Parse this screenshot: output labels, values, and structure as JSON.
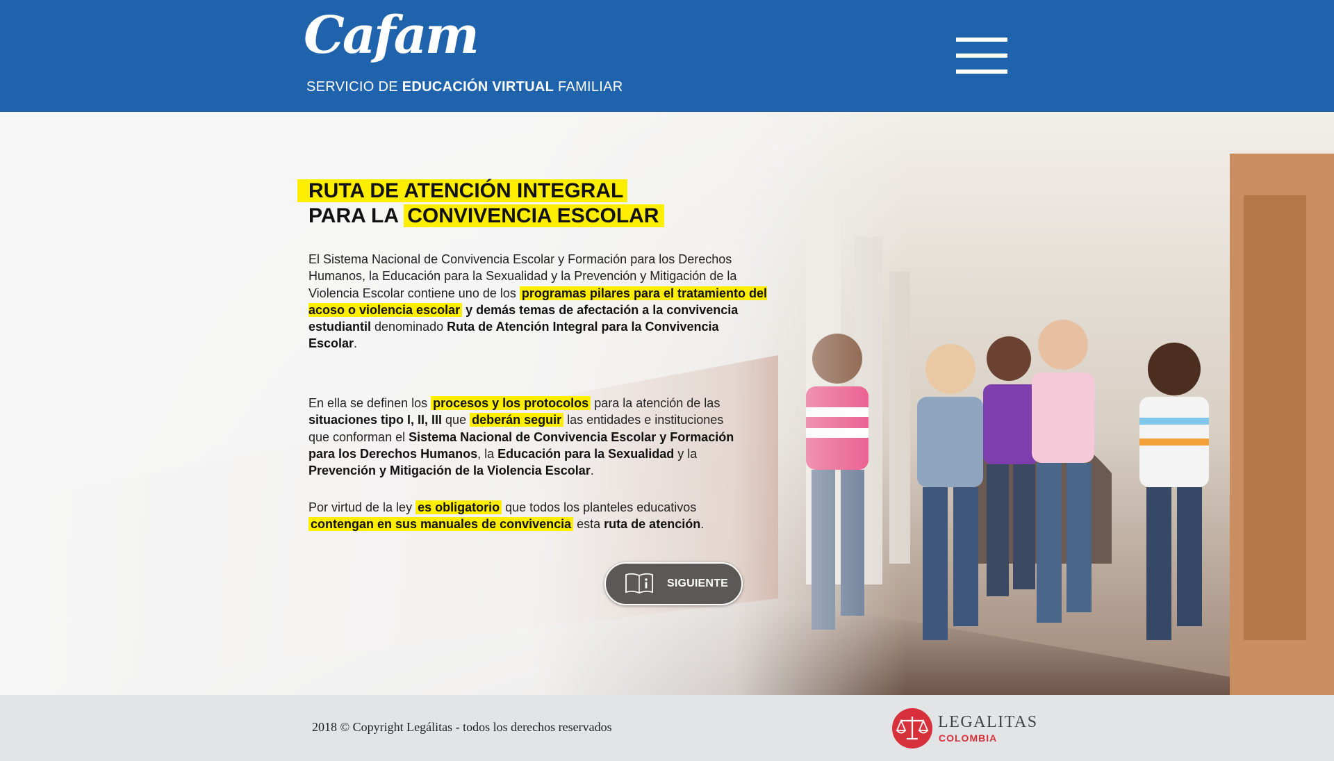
{
  "header": {
    "logo_text": "Cafam",
    "tagline_pre": "SERVICIO DE ",
    "tagline_bold": "EDUCACIÓN VIRTUAL",
    "tagline_post": " FAMILIAR",
    "menu_icon": "hamburger-icon"
  },
  "hero": {
    "title_line1": "RUTA DE ATENCIÓN INTEGRAL",
    "title_line2_pre": "PARA LA ",
    "title_line2_hl": "CONVIVENCIA ESCOLAR",
    "p1": {
      "t1": "El Sistema Nacional de Convivencia Escolar y Formación para los Derechos Humanos, la Educación para la Sexualidad y la Prevención y Mitigación de la Violencia Escolar contiene uno de los ",
      "hl1": "programas pilares para el tratamiento del acoso o violencia escolar",
      "b1": " y demás temas de afectación a la convivencia estudiantil",
      "t2": " denominado ",
      "b2": "Ruta de Atención Integral para la Convivencia Escolar",
      "t3": "."
    },
    "p2": {
      "t1": "En ella se definen los ",
      "hl1": "procesos y los protocolos",
      "t2": " para la atención de las ",
      "b1": "situaciones tipo I, II, III",
      "t3": " que ",
      "hl2": "deberán seguir",
      "t4": " las entidades e instituciones que conforman el ",
      "b2": "Sistema Nacional de Convivencia Escolar y Formación para los Derechos Humanos",
      "t5": ", la ",
      "b3": "Educación para la Sexualidad",
      "t6": " y la ",
      "b4": "Prevención y Mitigación de la Violencia Escolar",
      "t7": "."
    },
    "p3": {
      "t1": "Por virtud de la ley ",
      "hl1": "es obligatorio",
      "t2": " que todos los planteles educativos ",
      "hl2": "contengan en sus manuales de convivencia",
      "t3": " esta ",
      "b1": "ruta de atención",
      "t4": "."
    },
    "next_button": {
      "label": "SIGUIENTE",
      "icon": "book-info-icon"
    },
    "highlight_color": "#ffee00"
  },
  "footer": {
    "copyright": "2018 © Copyright Legálitas - todos los derechos reservados",
    "brand_name": "LEGALITAS",
    "brand_country": "COLOMBIA",
    "brand_icon": "scales-icon",
    "brand_color": "#d6303b"
  },
  "colors": {
    "header_bg": "#1f63ad",
    "footer_bg": "#e3e4e6",
    "button_bg": "#5b5857"
  }
}
